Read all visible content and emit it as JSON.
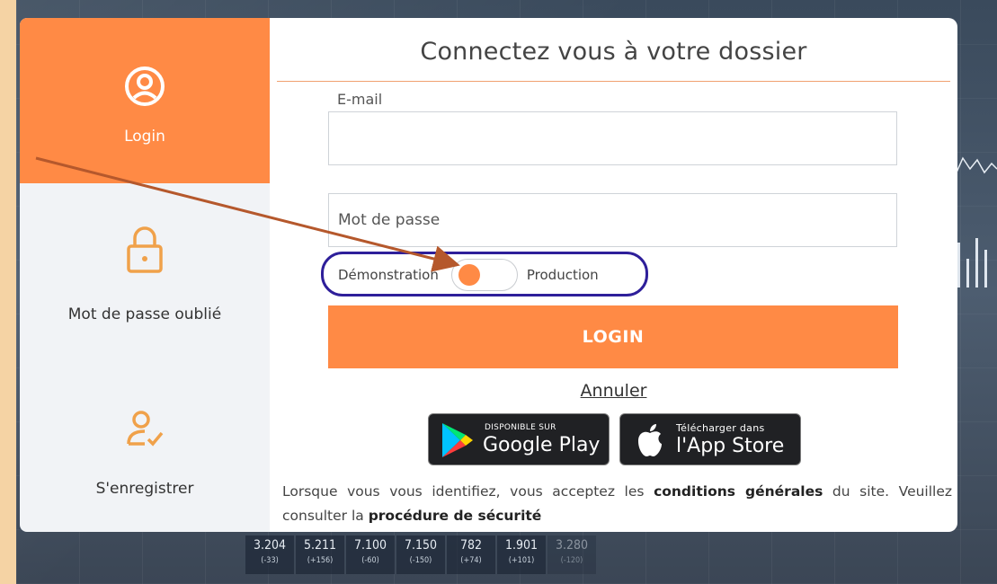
{
  "sidebar": {
    "items": [
      {
        "label": "Login",
        "icon": "user-circle-icon",
        "active": true
      },
      {
        "label": "Mot de passe oublié",
        "icon": "lock-icon",
        "active": false
      },
      {
        "label": "S'enregistrer",
        "icon": "user-check-icon",
        "active": false
      }
    ]
  },
  "main": {
    "title": "Connectez vous à votre dossier",
    "email_label": "E-mail",
    "email_value": "",
    "password_placeholder": "Mot de passe",
    "toggle": {
      "left_label": "Démonstration",
      "right_label": "Production",
      "selected": "Démonstration"
    },
    "login_button": "LOGIN",
    "cancel_link": "Annuler",
    "stores": {
      "google": {
        "small": "DISPONIBLE SUR",
        "big": "Google Play"
      },
      "apple": {
        "small": "Télécharger dans",
        "big": "l'App Store"
      }
    },
    "terms": {
      "part1": "Lorsque vous vous identifiez, vous acceptez les ",
      "link1": "conditions générales",
      "part2": " du site. Veuillez consulter la ",
      "link2": "procédure de sécurité"
    }
  },
  "background_ticker": [
    {
      "value": "3.204",
      "change": "(-33)"
    },
    {
      "value": "5.211",
      "change": "(+156)"
    },
    {
      "value": "7.100",
      "change": "(-60)"
    },
    {
      "value": "7.150",
      "change": "(-150)"
    },
    {
      "value": "782",
      "change": "(+74)"
    },
    {
      "value": "1.901",
      "change": "(+101)"
    },
    {
      "value": "3.280",
      "change": "(-120)"
    }
  ],
  "colors": {
    "accent": "#ff8a45",
    "annotation": "#2e1f9a",
    "arrow": "#b5582c",
    "outer_border": "#f5d3a4"
  }
}
